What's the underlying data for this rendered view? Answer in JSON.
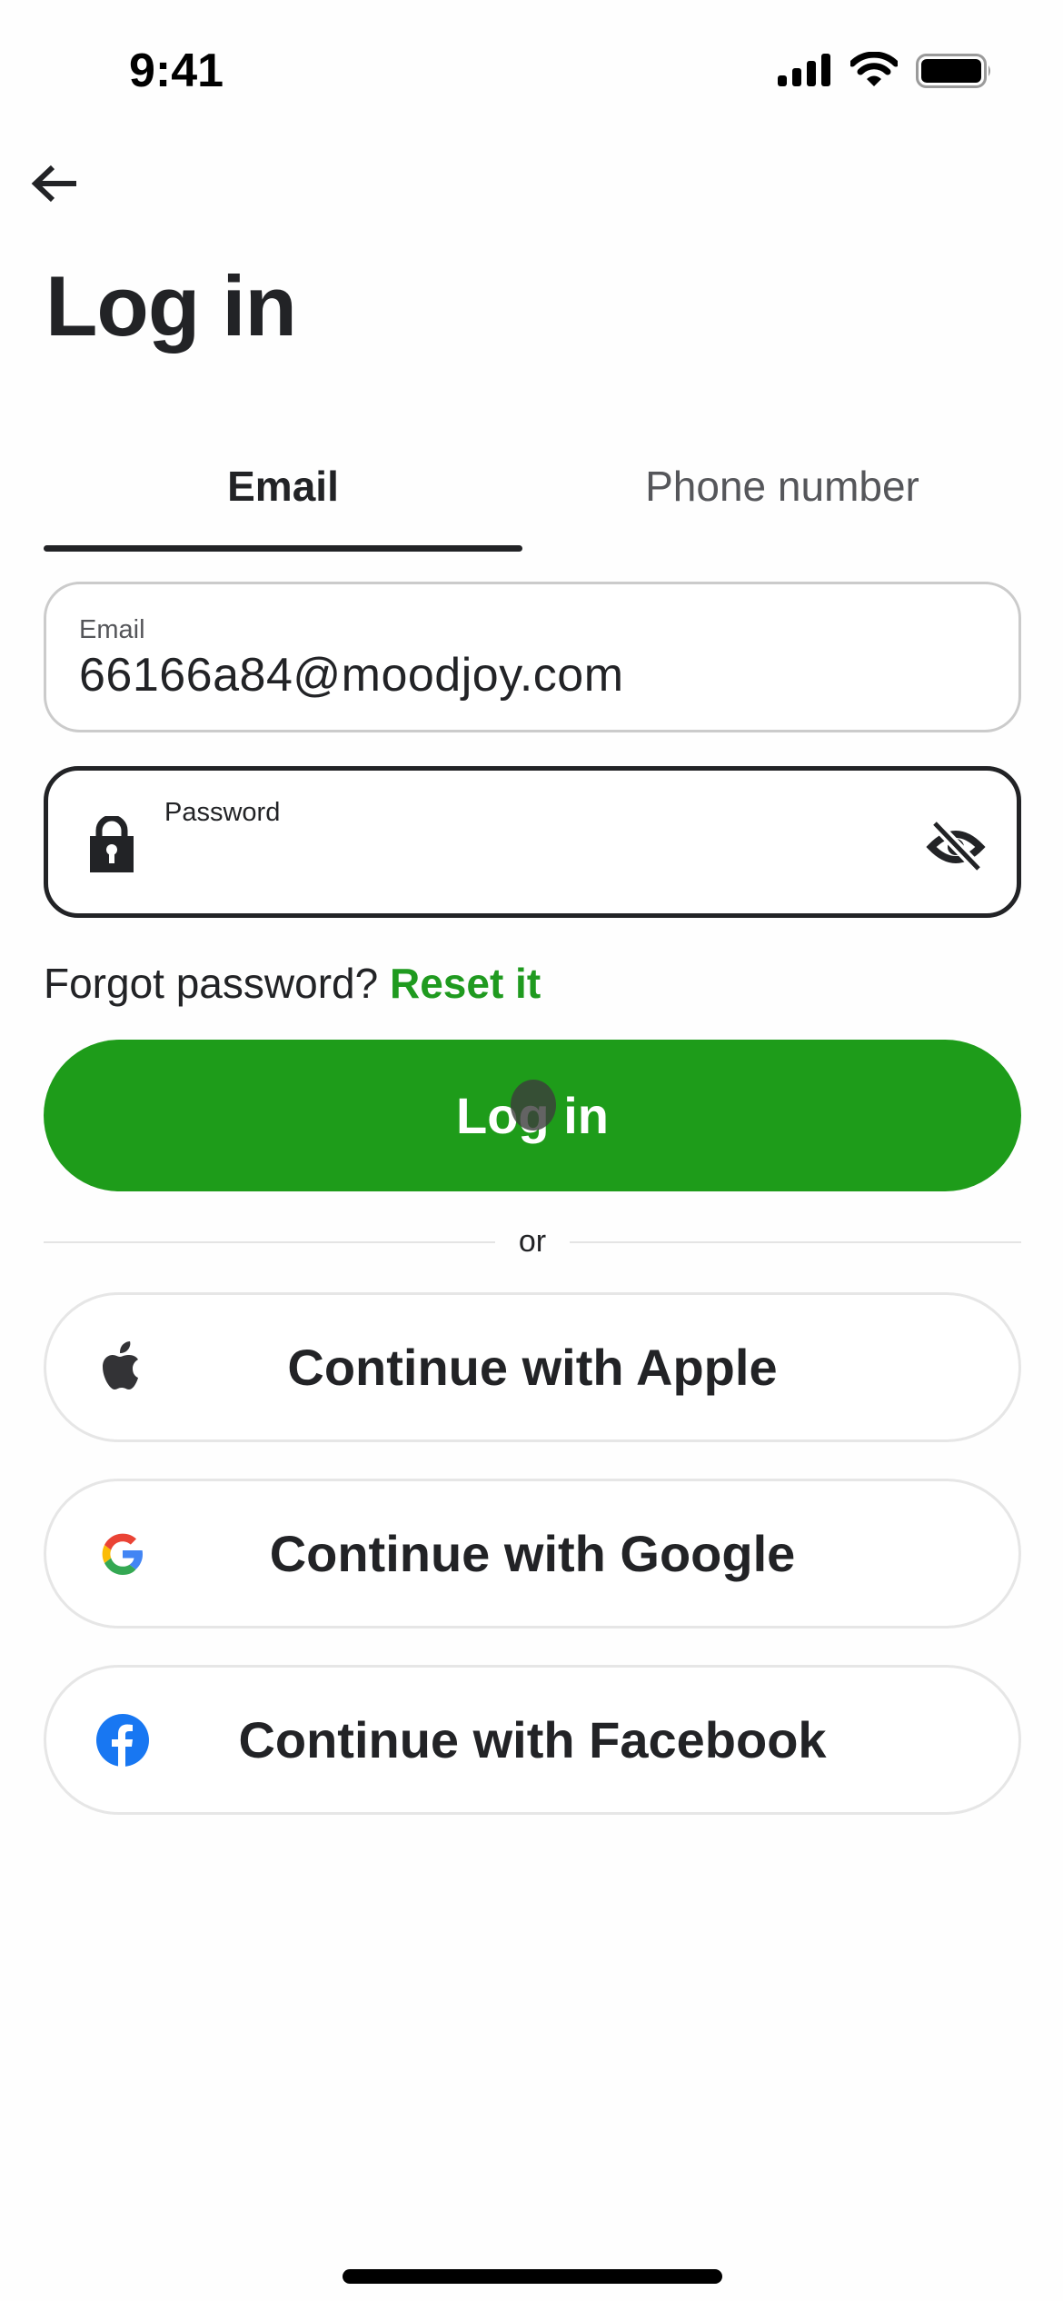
{
  "status_bar": {
    "time": "9:41",
    "icons": [
      "cellular-signal-icon",
      "wifi-icon",
      "battery-icon"
    ]
  },
  "nav": {
    "back_icon": "arrow-left-icon"
  },
  "header": {
    "title": "Log in"
  },
  "tabs": [
    {
      "label": "Email",
      "active": true
    },
    {
      "label": "Phone number",
      "active": false
    }
  ],
  "form": {
    "email": {
      "label": "Email",
      "value": "66166a84@moodjoy.com"
    },
    "password": {
      "label": "Password",
      "value": "",
      "leading_icon": "lock-icon",
      "trailing_icon": "eye-off-icon"
    },
    "forgot_text": "Forgot password?",
    "reset_link": "Reset it",
    "submit_label": "Log in"
  },
  "divider_text": "or",
  "social_buttons": [
    {
      "label": "Continue with Apple",
      "icon": "apple-icon"
    },
    {
      "label": "Continue with Google",
      "icon": "google-icon"
    },
    {
      "label": "Continue with Facebook",
      "icon": "facebook-icon"
    }
  ],
  "colors": {
    "brand_green": "#1e9c1a",
    "link_green": "#1f9a1f",
    "text_primary": "#222326",
    "text_secondary": "#55565a",
    "facebook_blue": "#1877f2"
  }
}
